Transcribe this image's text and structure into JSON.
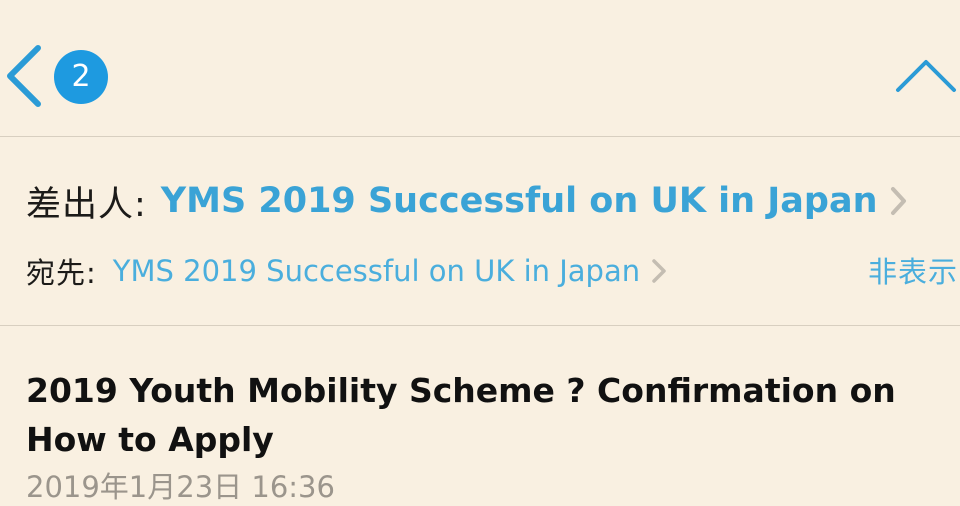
{
  "navigation": {
    "unread_count": "2"
  },
  "header": {
    "from_label": "差出人:",
    "from_name": "YMS 2019 Successful on UK in Japan",
    "to_label": "宛先:",
    "to_name": "YMS 2019 Successful on UK in Japan",
    "hide_label": "非表示"
  },
  "message": {
    "subject": "2019 Youth Mobility Scheme ? Confirmation on How to Apply",
    "date": "2019年1月23日 16:36"
  },
  "colors": {
    "background": "#f9f0e1",
    "accent": "#3aa3d6",
    "badge": "#1e9ae0",
    "secondary_text": "#9b958c"
  },
  "icons": {
    "back": "chevron-left-icon",
    "previous": "chevron-up-icon",
    "disclosure": "chevron-right-icon"
  }
}
